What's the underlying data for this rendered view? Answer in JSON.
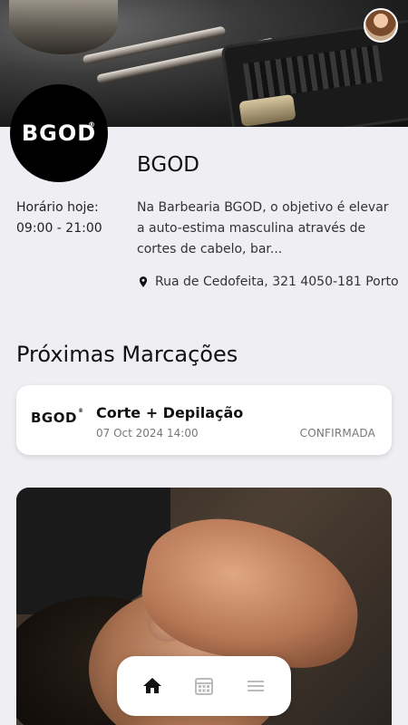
{
  "header": {
    "banner_image": "barber-tools-photo",
    "avatar": "user-avatar",
    "logo": {
      "text": "BGOD",
      "reg": "®"
    }
  },
  "shop": {
    "name": "BGOD",
    "hours_label": "Horário hoje:",
    "hours_value": "09:00 - 21:00",
    "description": "Na Barbearia BGOD, o objetivo é elevar a auto-estima masculina através de cortes de cabelo, bar...",
    "address": "Rua de Cedofeita, 321 4050-181 Porto"
  },
  "appointments": {
    "section_title": "Próximas Marcações",
    "items": [
      {
        "logo": "BGOD",
        "logo_reg": "®",
        "service": "Corte + Depilação",
        "datetime": "07 Oct 2024 14:00",
        "status": "CONFIRMADA"
      }
    ]
  },
  "hero": {
    "image": "beard-grooming-photo"
  },
  "tabbar": {
    "items": [
      {
        "name": "home",
        "icon": "home-icon",
        "active": true
      },
      {
        "name": "calendar",
        "icon": "calendar-icon",
        "active": false
      },
      {
        "name": "menu",
        "icon": "menu-icon",
        "active": false
      }
    ]
  },
  "colors": {
    "background": "#efeef2",
    "card": "#ffffff",
    "text": "#111111",
    "muted": "#777777",
    "icon_active": "#111111",
    "icon_inactive": "#bbbbbb"
  }
}
